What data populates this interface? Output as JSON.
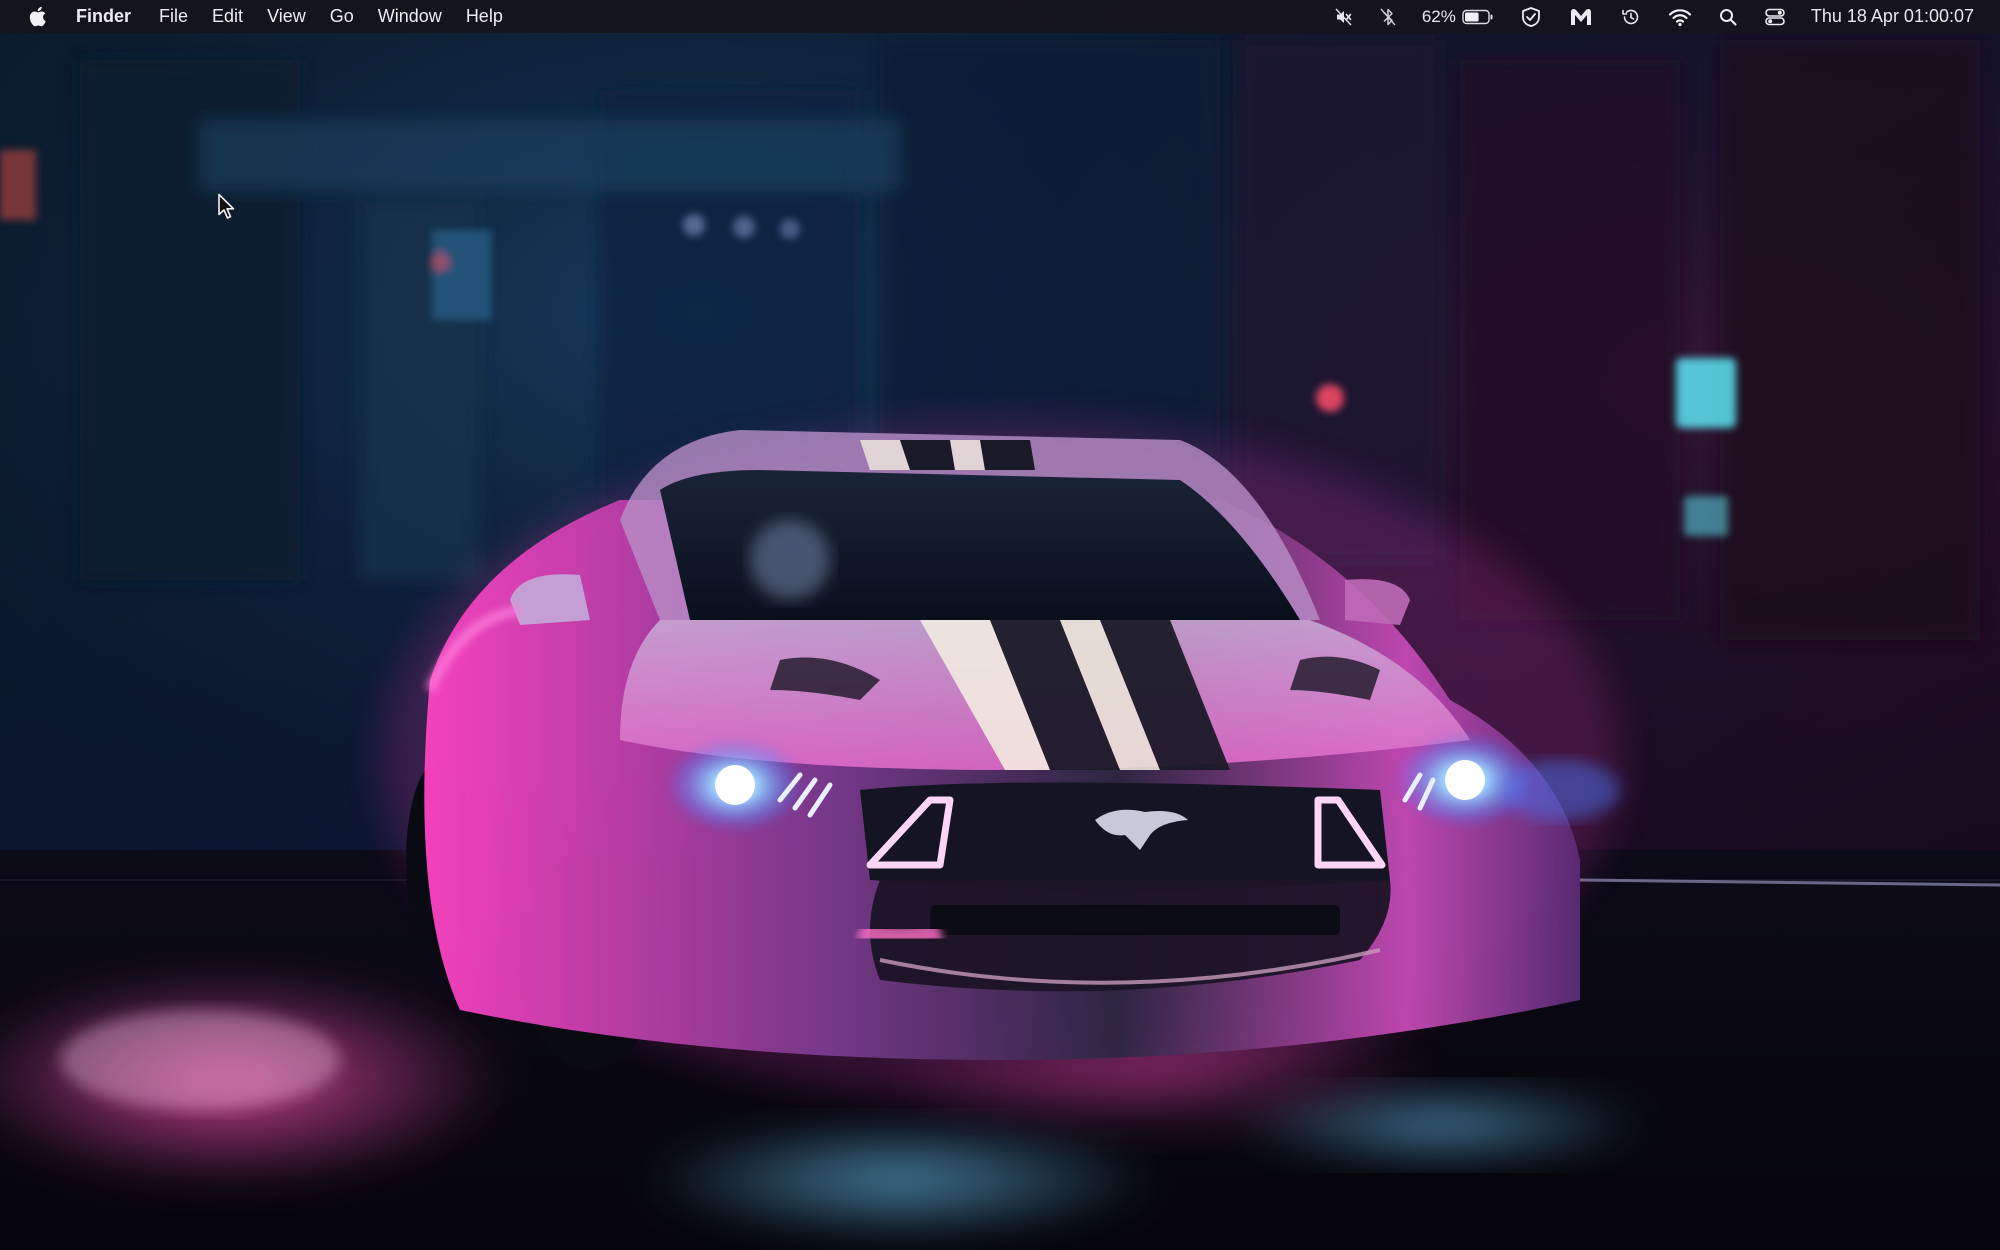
{
  "menubar": {
    "apple_icon": "apple-logo-icon",
    "app_name": "Finder",
    "menus": [
      "File",
      "Edit",
      "View",
      "Go",
      "Window",
      "Help"
    ],
    "status": {
      "mute_icon": "speaker-muted-icon",
      "bluetooth_icon": "bluetooth-off-icon",
      "battery_percent": "62%",
      "battery_level": 0.62,
      "battery_icon": "battery-icon",
      "vpn_icon": "shield-check-icon",
      "malwarebytes_icon": "malwarebytes-icon",
      "time_machine_icon": "time-machine-icon",
      "wifi_icon": "wifi-icon",
      "spotlight_icon": "search-icon",
      "control_center_icon": "control-center-icon",
      "clock": "Thu 18 Apr  01:00:07"
    }
  },
  "wallpaper": {
    "subject": "neon-car-wallpaper",
    "colors": {
      "magenta": "#ff3cc8",
      "blue": "#4aa8ff",
      "night": "#0a0815"
    }
  },
  "cursor": {
    "icon": "mouse-pointer-icon"
  }
}
